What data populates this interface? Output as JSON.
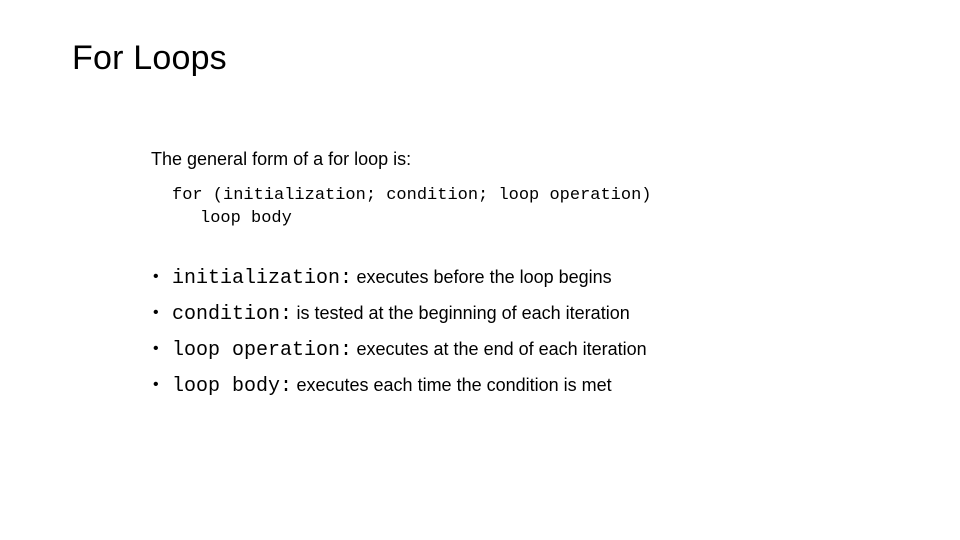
{
  "slide": {
    "title": "For Loops",
    "lead_line": "The general form of a for loop is:",
    "code_block": {
      "line1": "for (initialization; condition; loop operation)",
      "line2": "loop body"
    },
    "bullet_marker": "•",
    "bullets": [
      {
        "term": "initialization:",
        "description": "executes before the loop begins"
      },
      {
        "term": "condition:",
        "description": "is tested at the beginning of each iteration"
      },
      {
        "term": "loop operation:",
        "description": "executes at the end of each iteration"
      },
      {
        "term": "loop body:",
        "description": "executes each time the condition is met"
      }
    ]
  },
  "colors": {
    "background": "#ffffff",
    "text": "#000000"
  }
}
